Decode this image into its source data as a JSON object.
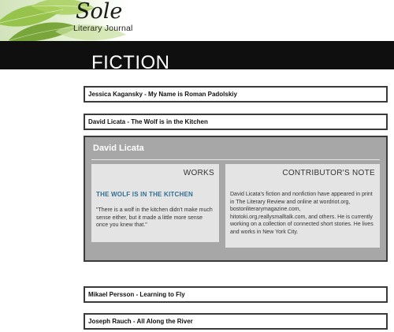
{
  "site": {
    "logo_main": "Sole",
    "logo_sub": "Literary Journal"
  },
  "page": {
    "title": "FICTION"
  },
  "stories": [
    {
      "label": "Jessica Kagansky - My Name is Roman Padolskiy"
    },
    {
      "label": "David Licata - The Wolf is in the Kitchen"
    },
    {
      "label": "Mikael Persson - Learning to Fly"
    },
    {
      "label": "Joseph Rauch - All Along the River"
    }
  ],
  "panel": {
    "author": "David Licata",
    "works_heading": "WORKS",
    "work_title": "THE WOLF IS IN THE KITCHEN",
    "excerpt": "\"There is a wolf in the kitchen didn't make much sense either, but it made a little more sense once you knew that.\"",
    "note_heading": "CONTRIBUTOR'S NOTE",
    "note_text": "David Licata's fiction and nonfiction have appeared in print in The Literary Review and online at wordriot.org, bostonliterarymagazine.com, hitotoki.org,reallysmalltalk.com, and others. He is currently working on a collection of connected short stories. He lives and works in New York City."
  },
  "colors": {
    "title_bar": "#0f0f0f",
    "panel_bg": "#a7a7a7",
    "card_bg": "#e4e4e4",
    "link": "#2f6f96"
  }
}
